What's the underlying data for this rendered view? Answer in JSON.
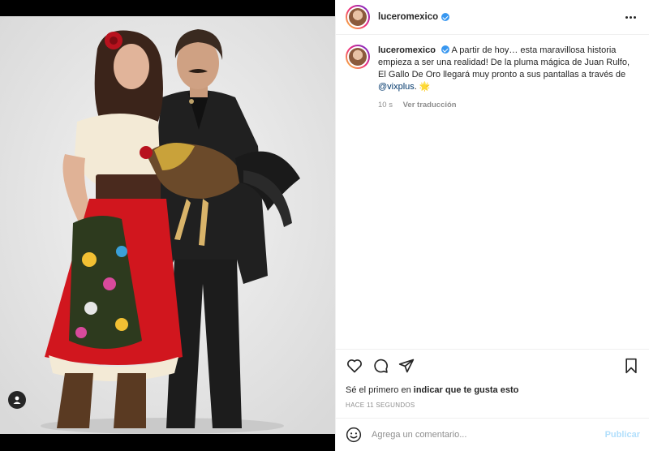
{
  "post": {
    "username": "luceromexico",
    "verified": true,
    "caption": "A partir de hoy… esta maravillosa historia empieza a ser una realidad! De la pluma mágica de Juan Rulfo, El Gallo De Oro llegará muy pronto a sus pantallas a través de",
    "mention": "@vixplus",
    "emoji": "🌟",
    "age": "10 s",
    "translate_label": "Ver traducción"
  },
  "likes": {
    "prefix": "Sé el primero en ",
    "action": "indicar que te gusta esto"
  },
  "time_ago": "HACE 11 SEGUNDOS",
  "comment": {
    "placeholder": "Agrega un comentario...",
    "publish_label": "Publicar"
  },
  "colors": {
    "verified": "#3897f0",
    "mention": "#00376b",
    "publish_disabled": "#b2dffc",
    "muted": "#8e8e8e"
  },
  "icons": [
    "heart-icon",
    "comment-icon",
    "share-icon",
    "bookmark-icon",
    "emoji-icon",
    "more-options-icon",
    "user-tag-icon"
  ]
}
